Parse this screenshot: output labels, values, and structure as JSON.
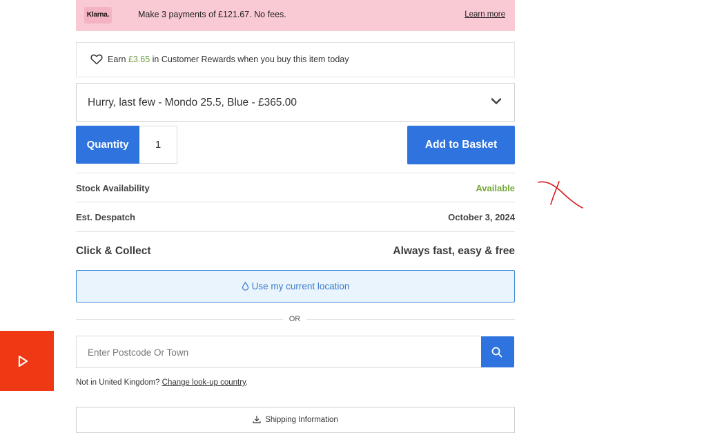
{
  "klarna": {
    "logo": "Klarna.",
    "text": "Make 3 payments of £121.67. No fees.",
    "learn_more": "Learn more"
  },
  "rewards": {
    "prefix": "Earn ",
    "amount": "£3.65",
    "suffix": " in Customer Rewards when you buy this item today"
  },
  "variant": {
    "selected": "Hurry, last few - Mondo 25.5, Blue - £365.00"
  },
  "quantity": {
    "label": "Quantity",
    "value": "1"
  },
  "basket": {
    "label": "Add to Basket"
  },
  "info": {
    "stock_label": "Stock Availability",
    "stock_value": "Available",
    "despatch_label": "Est. Despatch",
    "despatch_value": "October 3, 2024"
  },
  "collect": {
    "label": "Click & Collect",
    "value": "Always fast, easy & free",
    "location_button": "Use my current location",
    "or": "OR",
    "postcode_placeholder": "Enter Postcode Or Town",
    "not_uk": "Not in United Kingdom?",
    "change_country": "Change look-up country",
    "period": "."
  },
  "shipping": {
    "label": "Shipping Information"
  },
  "colors": {
    "primary_blue": "#2f74de",
    "klarna_pink": "#f9c9d4",
    "available_green": "#76a83c",
    "video_red": "#ef3814",
    "annotation_red": "#d9191f"
  },
  "icons": {
    "rewards": "heart-icon",
    "variant": "chevron-down-icon",
    "location": "pin-icon",
    "search": "search-icon",
    "shipping": "download-icon",
    "video": "play-icon"
  }
}
